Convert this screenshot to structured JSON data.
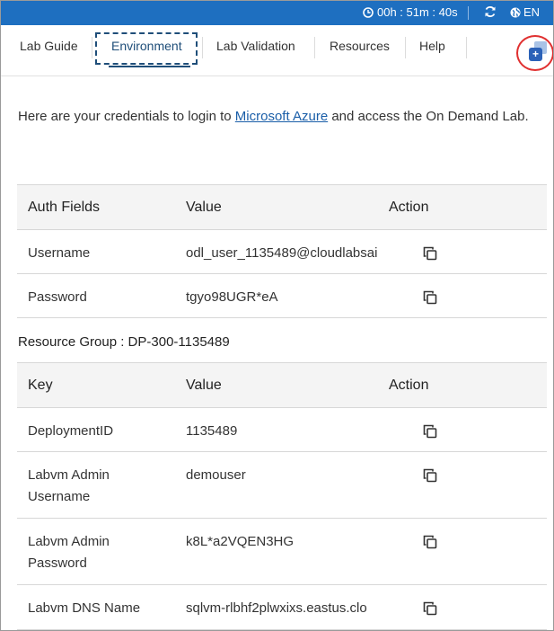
{
  "topbar": {
    "timer": "00h : 51m : 40s",
    "language": "EN",
    "bg_color": "#1e6fc0"
  },
  "tabs": [
    {
      "label": "Lab Guide"
    },
    {
      "label": "Environment",
      "active": true
    },
    {
      "label": "Lab Validation"
    },
    {
      "label": "Resources"
    },
    {
      "label": "Help"
    }
  ],
  "intro": {
    "before": "Here are your credentials to login to ",
    "link": "Microsoft Azure",
    "after": " and access the On Demand Lab."
  },
  "credentials": {
    "headers": [
      "Auth Fields",
      "Value",
      "Action"
    ],
    "rows": [
      {
        "field": "Username",
        "value": "odl_user_1135489@cloudlabsai"
      },
      {
        "field": "Password",
        "value": "tgyo98UGR*eA"
      }
    ]
  },
  "resource_group": {
    "title": "Resource Group : DP-300-1135489",
    "headers": [
      "Key",
      "Value",
      "Action"
    ],
    "rows": [
      {
        "key": "DeploymentID",
        "value": "1135489"
      },
      {
        "key": "Labvm Admin Username",
        "value": "demouser"
      },
      {
        "key": "Labvm Admin Password",
        "value": "k8L*a2VQEN3HG"
      },
      {
        "key": "Labvm DNS Name",
        "value": "sqlvm-rlbhf2plwxixs.eastus.clo"
      }
    ]
  },
  "icons": {
    "timer": "clock-icon",
    "refresh": "refresh-icon",
    "language": "globe-icon",
    "copy": "copy-icon",
    "popout": "popout-window-icon"
  },
  "colors": {
    "accent": "#1f4e79",
    "link": "#1a5ea8",
    "highlight_circle": "#e03030"
  }
}
